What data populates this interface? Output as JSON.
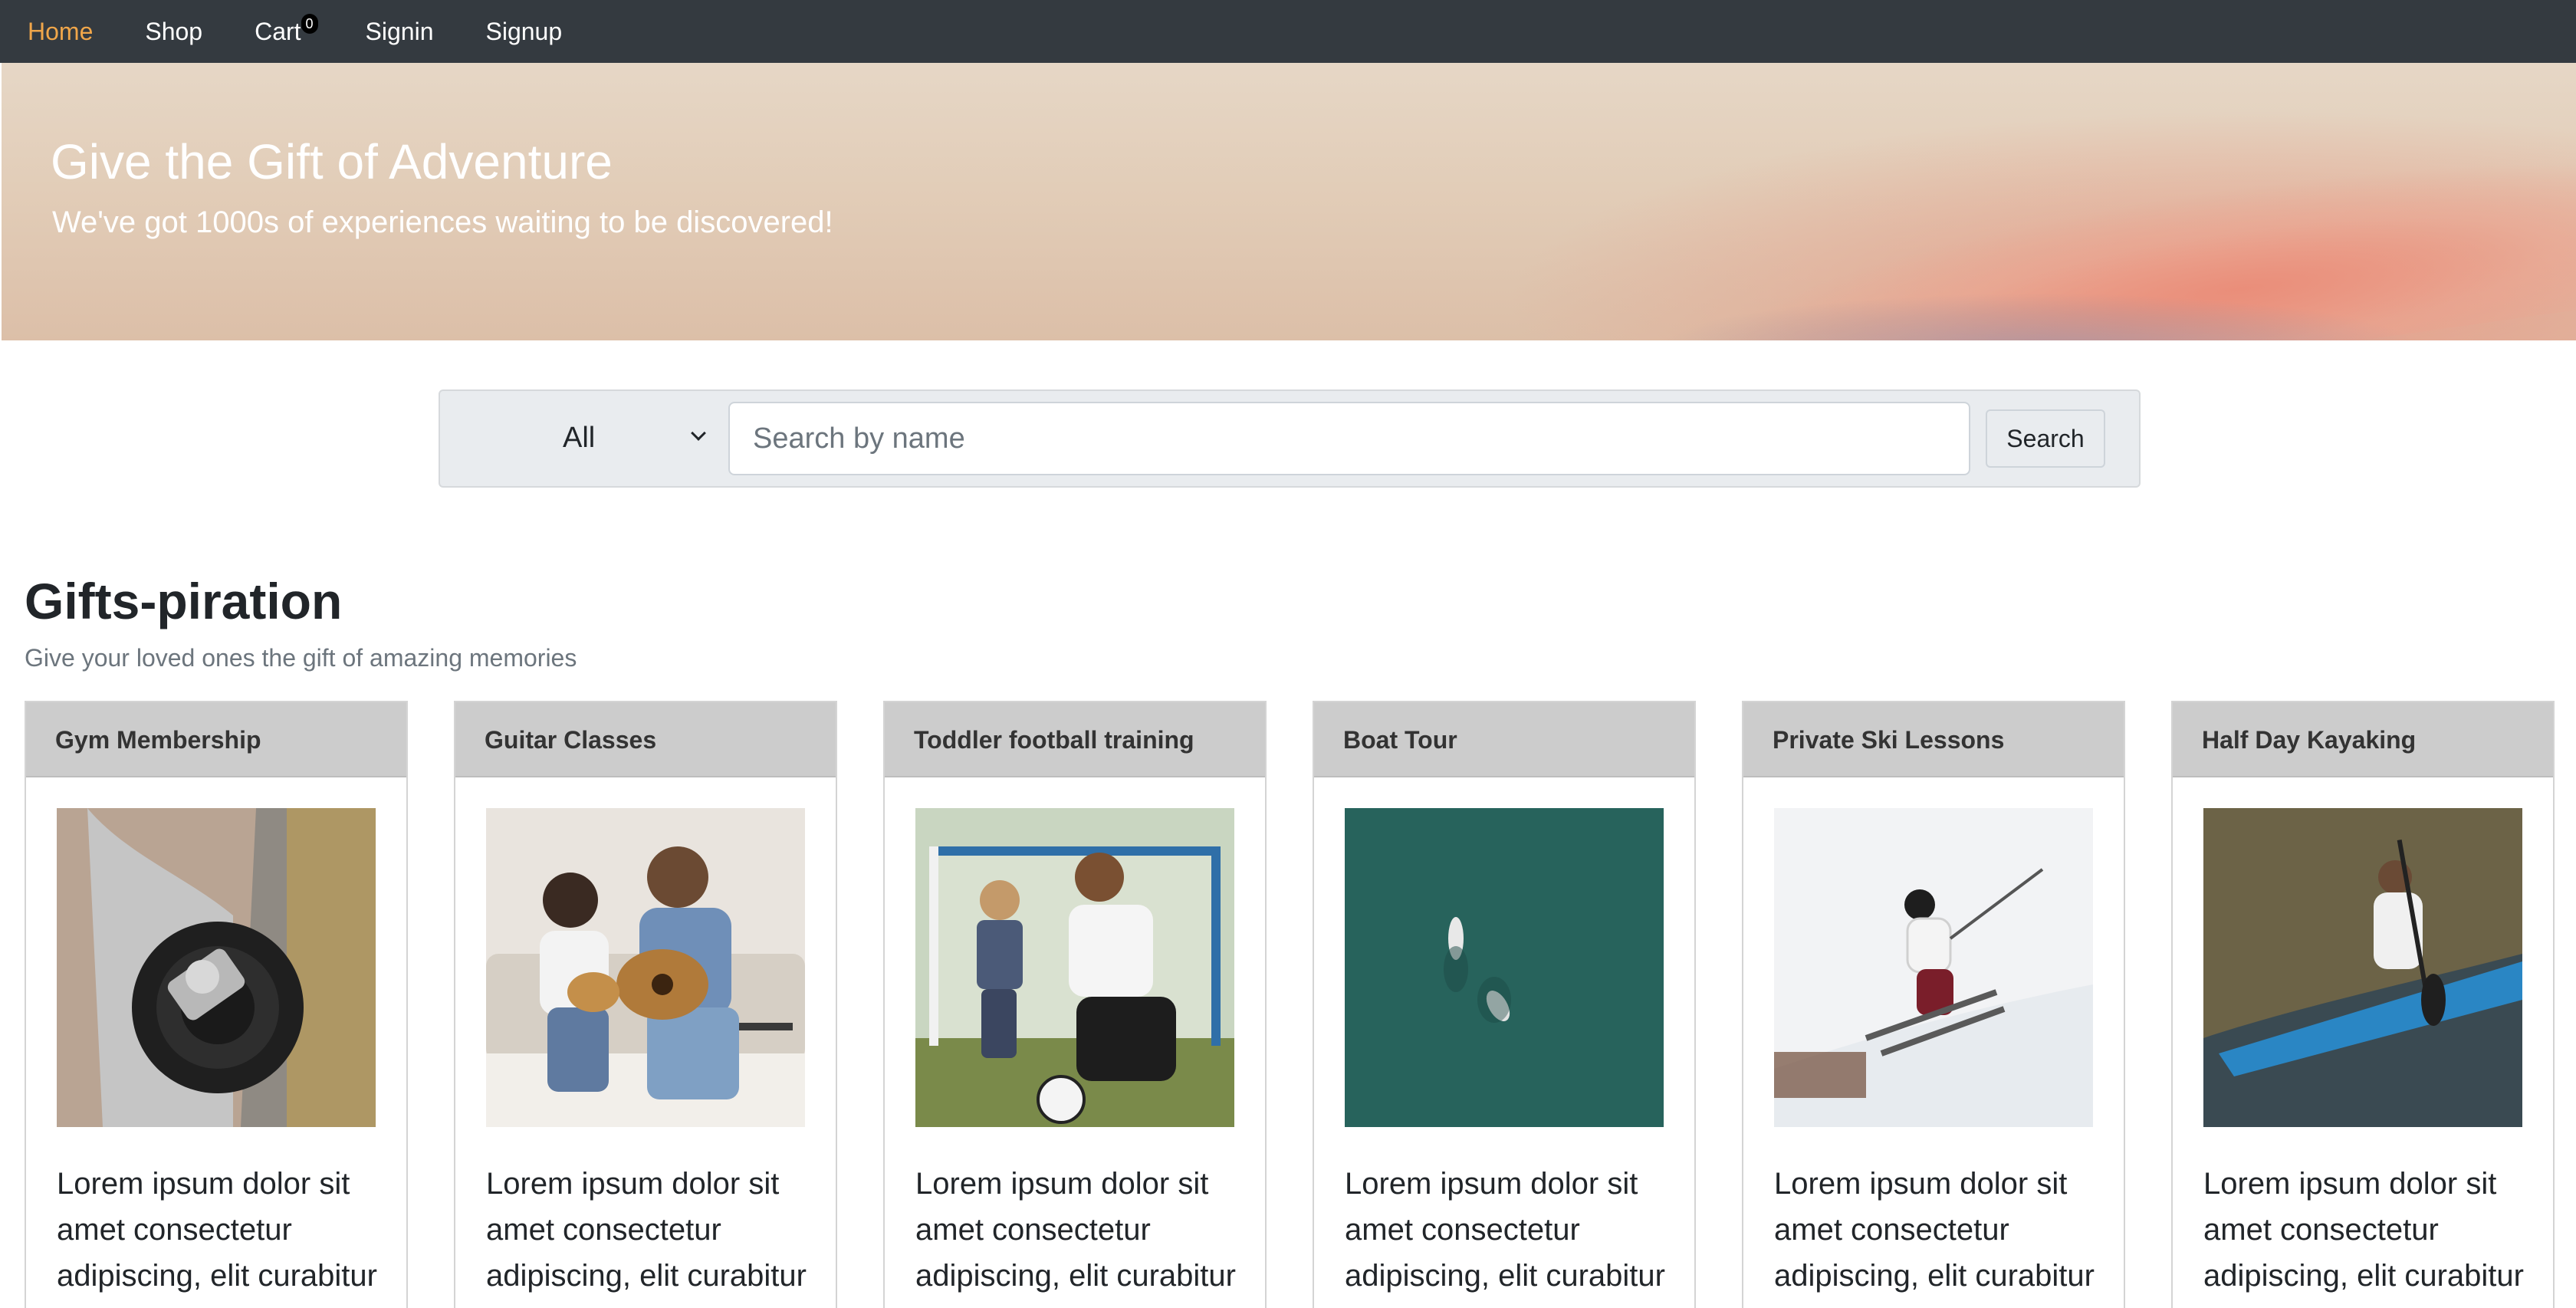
{
  "nav": {
    "items": [
      {
        "label": "Home",
        "active": true
      },
      {
        "label": "Shop",
        "active": false
      },
      {
        "label": "Cart",
        "active": false
      },
      {
        "label": "Signin",
        "active": false
      },
      {
        "label": "Signup",
        "active": false
      }
    ],
    "cart_count": "0",
    "active_color": "#f0a64a",
    "bg_color": "#343a40"
  },
  "hero": {
    "title": "Give the Gift of Adventure",
    "subtitle": "We've got 1000s of experiences waiting to be discovered!"
  },
  "search": {
    "category_selected": "All",
    "placeholder": "Search by name",
    "button_label": "Search"
  },
  "section": {
    "title": "Gifts-piration",
    "subtitle": "Give your loved ones the gift of amazing memories"
  },
  "cards": [
    {
      "title": "Gym Membership",
      "text": "Lorem ipsum dolor sit amet consectetur adipiscing, elit curabitur",
      "image": "dumbbell-photo"
    },
    {
      "title": "Guitar Classes",
      "text": "Lorem ipsum dolor sit amet consectetur adipiscing, elit curabitur",
      "image": "guitar-lesson-photo"
    },
    {
      "title": "Toddler football training",
      "text": "Lorem ipsum dolor sit amet consectetur adipiscing, elit curabitur",
      "image": "football-highfive-photo"
    },
    {
      "title": "Boat Tour",
      "text": "Lorem ipsum dolor sit amet consectetur adipiscing, elit curabitur",
      "image": "aerial-boats-photo"
    },
    {
      "title": "Private Ski Lessons",
      "text": "Lorem ipsum dolor sit amet consectetur adipiscing, elit curabitur",
      "image": "skier-photo"
    },
    {
      "title": "Half Day Kayaking",
      "text": "Lorem ipsum dolor sit amet consectetur adipiscing, elit curabitur",
      "image": "kayaker-photo"
    }
  ]
}
